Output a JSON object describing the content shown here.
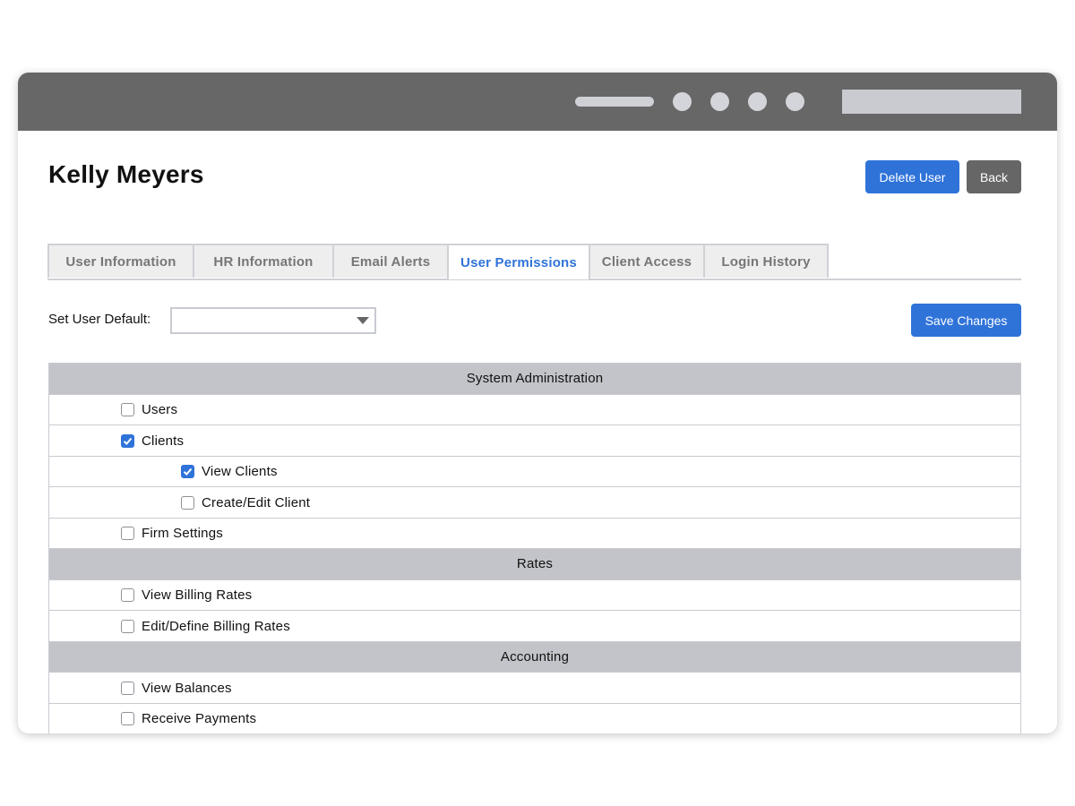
{
  "colors": {
    "primary": "#2f73d9",
    "secondary_button": "#666666",
    "titlebar": "#676767",
    "section_header": "#c3c4c9"
  },
  "header": {
    "title": "Kelly Meyers",
    "delete_label": "Delete User",
    "back_label": "Back"
  },
  "tabs": [
    {
      "label": "User Information",
      "active": false
    },
    {
      "label": "HR Information",
      "active": false
    },
    {
      "label": "Email Alerts",
      "active": false
    },
    {
      "label": "User Permissions",
      "active": true
    },
    {
      "label": "Client Access",
      "active": false
    },
    {
      "label": "Login History",
      "active": false
    }
  ],
  "default": {
    "label": "Set User Default:",
    "selected": ""
  },
  "save_label": "Save Changes",
  "permissions": {
    "system_admin": {
      "title": "System Administration",
      "users": {
        "label": "Users",
        "checked": false
      },
      "clients": {
        "label": "Clients",
        "checked": true
      },
      "view_clients": {
        "label": "View Clients",
        "checked": true
      },
      "create_edit_client": {
        "label": "Create/Edit Client",
        "checked": false
      },
      "firm_settings": {
        "label": "Firm Settings",
        "checked": false
      }
    },
    "rates": {
      "title": "Rates",
      "view_billing_rates": {
        "label": "View Billing Rates",
        "checked": false
      },
      "edit_billing_rates": {
        "label": "Edit/Define Billing Rates",
        "checked": false
      }
    },
    "accounting": {
      "title": "Accounting",
      "view_balances": {
        "label": "View Balances",
        "checked": false
      },
      "receive_payments": {
        "label": "Receive Payments",
        "checked": false
      }
    }
  }
}
